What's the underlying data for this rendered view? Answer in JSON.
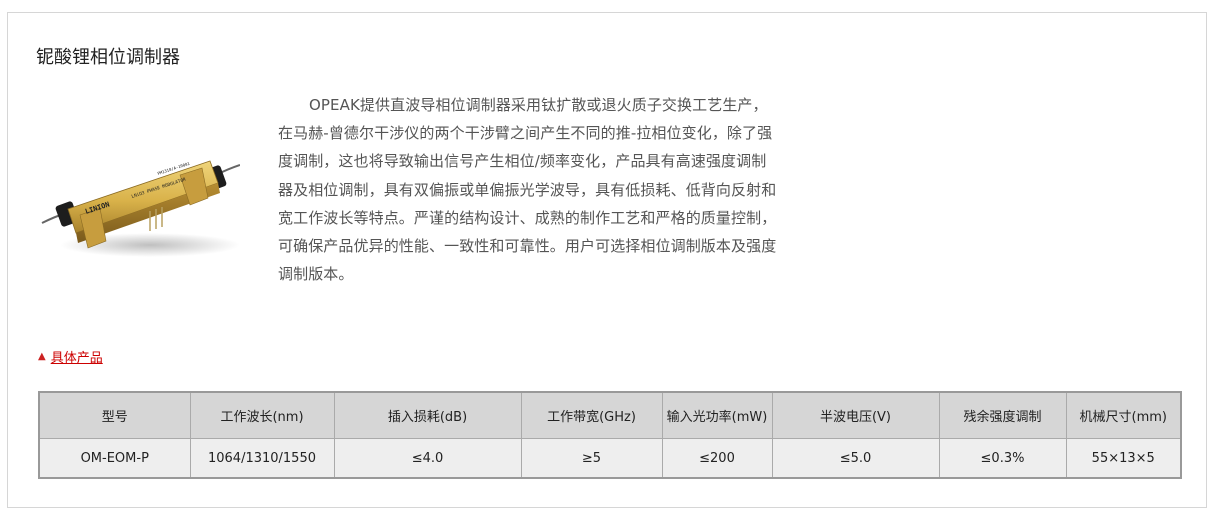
{
  "section": {
    "title": "铌酸锂相位调制器",
    "description": "OPEAK提供直波导相位调制器采用钛扩散或退火质子交换工艺生产，在马赫-曾德尔干涉仪的两个干涉臂之间产生不同的推-拉相位变化，除了强度调制，这也将导致输出信号产生相位/频率变化，产品具有高速强度调制器及相位调制，具有双偏振或单偏振光学波导，具有低损耗、低背向反射和宽工作波长等特点。严谨的结构设计、成熟的制作工艺和严格的质量控制，可确保产品优异的性能、一致性和可靠性。用户可选择相位调制版本及强度调制版本。",
    "product_image": {
      "brand_label": "LINION",
      "part_label": "PM1310/A-10001",
      "type_label": "LNiO3 PHASE MODULATOR"
    },
    "link_label": "具体产品",
    "link_icon": "triangle-up-icon",
    "accent_color": "#cc0000"
  },
  "spec_table": {
    "headers": [
      "型号",
      "工作波长(nm)",
      "插入损耗(dB)",
      "工作带宽(GHz)",
      "输入光功率(mW)",
      "半波电压(V)",
      "残余强度调制",
      "机械尺寸(mm)"
    ],
    "rows": [
      [
        "OM-EOM-P",
        "1064/1310/1550",
        "≤4.0",
        "≥5",
        "≤200",
        "≤5.0",
        "≤0.3%",
        "55×13×5"
      ]
    ]
  }
}
